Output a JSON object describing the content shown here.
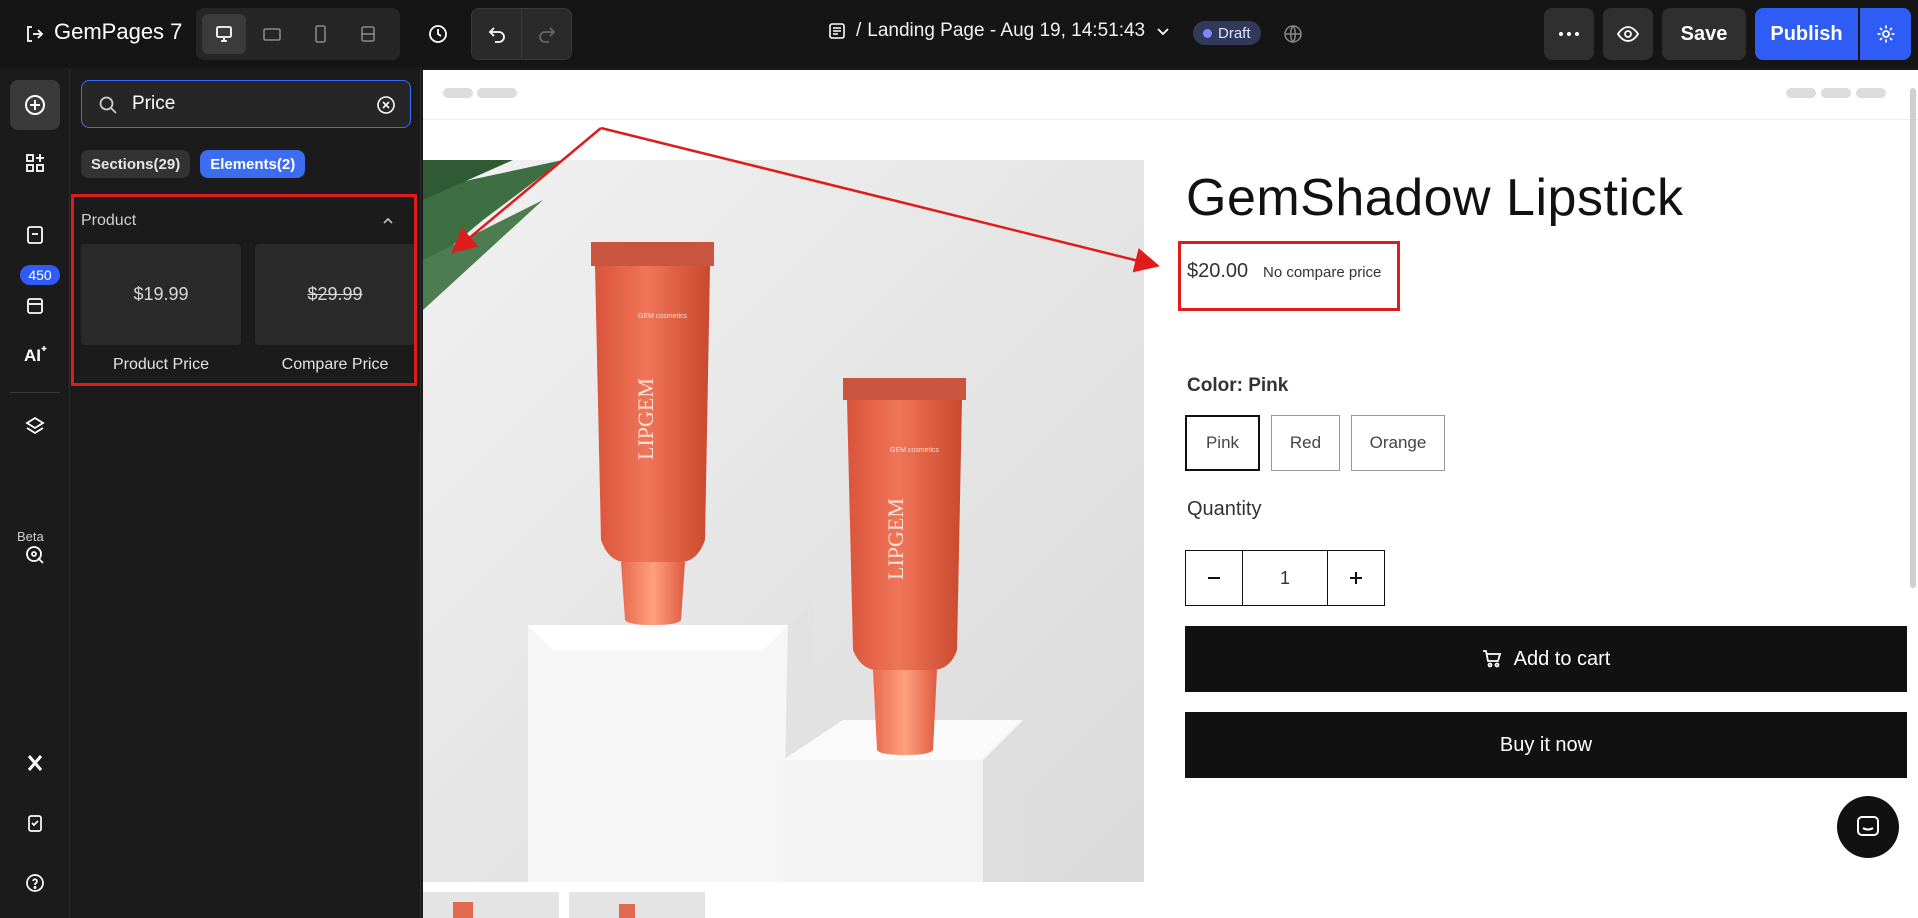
{
  "app": {
    "brand": "GemPages 7"
  },
  "header": {
    "page_prefix": "/",
    "page_name": "Landing Page - Aug 19, 14:51:43",
    "status": "Draft",
    "save_label": "Save",
    "publish_label": "Publish",
    "colors": {
      "accent": "#2f5cf5",
      "bg": "#151515"
    }
  },
  "rail": {
    "inventory_badge": "450",
    "beta_label": "Beta"
  },
  "panel": {
    "search_value": "Price",
    "tabs": [
      {
        "label": "Sections(29)",
        "active": false
      },
      {
        "label": "Elements(2)",
        "active": true
      }
    ],
    "group_title": "Product",
    "elements": [
      {
        "preview": "$19.99",
        "label": "Product Price"
      },
      {
        "preview": "$29.99",
        "label": "Compare Price"
      }
    ]
  },
  "product": {
    "title": "GemShadow Lipstick",
    "price": "$20.00",
    "compare_price": "No compare price",
    "color_label": "Color:",
    "color_value": "Pink",
    "colors": [
      "Pink",
      "Red",
      "Orange"
    ],
    "quantity_label": "Quantity",
    "quantity": "1",
    "add_to_cart": "Add to cart",
    "buy_now": "Buy it now",
    "tube_brand": "LIPGEM",
    "tube_small": "GEM cosmetics"
  }
}
